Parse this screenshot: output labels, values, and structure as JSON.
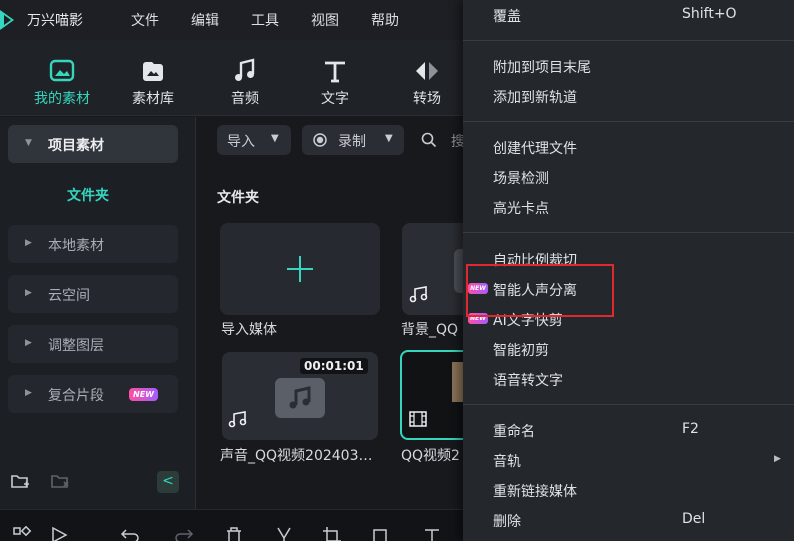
{
  "app": {
    "name": "万兴喵影"
  },
  "menubar": {
    "items": [
      "文件",
      "编辑",
      "工具",
      "视图",
      "帮助"
    ]
  },
  "toolbar": {
    "tools": [
      {
        "label": "我的素材",
        "icon": "my-media-icon",
        "active": true
      },
      {
        "label": "素材库",
        "icon": "stock-media-icon",
        "active": false
      },
      {
        "label": "音频",
        "icon": "music-note-icon",
        "active": false
      },
      {
        "label": "文字",
        "icon": "text-t-icon",
        "active": false
      },
      {
        "label": "转场",
        "icon": "transition-icon",
        "active": false
      }
    ]
  },
  "sidebar": {
    "project_media": "项目素材",
    "folder": "文件夹",
    "items": [
      {
        "label": "本地素材"
      },
      {
        "label": "云空间"
      },
      {
        "label": "调整图层"
      },
      {
        "label": "复合片段",
        "badge": "NEW"
      }
    ],
    "collapse_glyph": "<"
  },
  "main": {
    "import_label": "导入",
    "record_label": "录制",
    "search_label": "搜",
    "folder_title": "文件夹",
    "cards": [
      {
        "label": "导入媒体",
        "kind": "import"
      },
      {
        "label": "背景_QQ",
        "kind": "audio"
      },
      {
        "label": "声音_QQ视频202403…",
        "kind": "audio",
        "duration": "00:01:01"
      },
      {
        "label": "QQ视频2",
        "kind": "video"
      }
    ]
  },
  "context_menu": {
    "items": [
      {
        "label": "覆盖",
        "shortcut": "Shift+O"
      },
      {
        "label": "附加到项目末尾"
      },
      {
        "label": "添加到新轨道"
      },
      {
        "label": "创建代理文件"
      },
      {
        "label": "场景检测"
      },
      {
        "label": "高光卡点"
      },
      {
        "label": "自动比例裁切"
      },
      {
        "label": "智能人声分离",
        "badge": "NEW",
        "highlighted": true
      },
      {
        "label": "AI文字快剪",
        "badge": "NEW"
      },
      {
        "label": "智能初剪"
      },
      {
        "label": "语音转文字"
      },
      {
        "label": "重命名",
        "shortcut": "F2"
      },
      {
        "label": "音轨",
        "submenu": true
      },
      {
        "label": "重新链接媒体"
      },
      {
        "label": "删除",
        "shortcut": "Del"
      }
    ]
  },
  "colors": {
    "accent": "#35d6bd",
    "highlight": "#e0282f",
    "menu_bg": "#24272c"
  }
}
